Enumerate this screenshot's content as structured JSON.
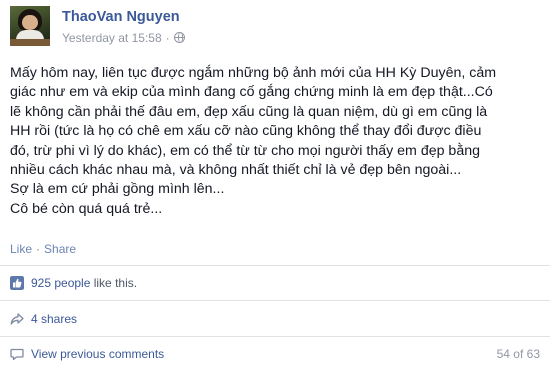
{
  "post": {
    "author": "ThaoVan Nguyen",
    "timestamp": "Yesterday at 15:58",
    "meta_separator": "·",
    "privacy_icon": "globe-icon",
    "lines": [
      "Mấy hôm nay, liên tục được ngắm những bộ ảnh mới của HH Kỳ Duyên, cảm",
      "giác như em và ekip của mình đang cố gắng chứng minh là em đẹp thật...Có",
      "lẽ không cần phải thế đâu em, đẹp xấu cũng là quan niệm, dù gì em cũng là",
      "HH rồi (tức là họ có chê em xấu cỡ nào cũng không thể thay đổi được điều",
      "đó, trừ phi vì lý do khác), em có thể từ từ cho mọi người thấy em đẹp bằng",
      "nhiều cách khác nhau mà, và không nhất thiết chỉ là vẻ đẹp bên ngoài...",
      "Sợ là em cứ phải gồng mình lên...",
      "Cô bé còn quá quá trẻ..."
    ]
  },
  "actions": {
    "like_label": "Like",
    "separator": "·",
    "share_label": "Share"
  },
  "likes": {
    "icon": "thumbs-up-icon",
    "count_text": "925 people",
    "suffix": " like this."
  },
  "shares": {
    "icon": "share-arrow-icon",
    "text": "4 shares"
  },
  "comments": {
    "icon": "comment-bubble-icon",
    "view_previous": "View previous comments",
    "paging": "54 of 63"
  },
  "colors": {
    "link": "#3b5998",
    "muted": "#9197a3",
    "divider": "#e1e2e3"
  }
}
